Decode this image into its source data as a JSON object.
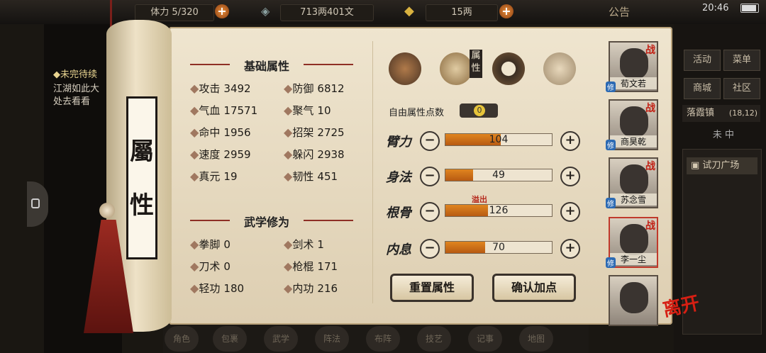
{
  "topbar": {
    "stamina": "5/320",
    "stamina_prefix": "体力",
    "money": "713两401文",
    "gold": "15两",
    "notice": "公告",
    "time": "20:46"
  },
  "quest": {
    "title": "◆未完待续",
    "lines": [
      "江湖如此大",
      "处去看看"
    ]
  },
  "roller": {
    "char1": "屬",
    "char2": "性"
  },
  "basic": {
    "title": "基础属性",
    "stats": [
      {
        "label": "攻击",
        "value": "3492"
      },
      {
        "label": "防御",
        "value": "6812"
      },
      {
        "label": "气血",
        "value": "17571"
      },
      {
        "label": "聚气",
        "value": "10"
      },
      {
        "label": "命中",
        "value": "1956"
      },
      {
        "label": "招架",
        "value": "2725"
      },
      {
        "label": "速度",
        "value": "2959"
      },
      {
        "label": "躲闪",
        "value": "2938"
      },
      {
        "label": "真元",
        "value": "19"
      },
      {
        "label": "韧性",
        "value": "451"
      }
    ]
  },
  "martial": {
    "title": "武学修为",
    "stats": [
      {
        "label": "拳脚",
        "value": "0"
      },
      {
        "label": "剑术",
        "value": "1"
      },
      {
        "label": "刀术",
        "value": "0"
      },
      {
        "label": "枪棍",
        "value": "171"
      },
      {
        "label": "轻功",
        "value": "180"
      },
      {
        "label": "内功",
        "value": "216"
      }
    ]
  },
  "tabs": {
    "attr_label": "属性"
  },
  "free_points": {
    "label": "自由属性点数",
    "value": "0"
  },
  "attributes": [
    {
      "name": "臂力",
      "value": "104",
      "level": 0.52
    },
    {
      "name": "身法",
      "value": "49",
      "level": 0.26
    },
    {
      "name": "根骨",
      "value": "126",
      "level": 0.4
    },
    {
      "name": "内息",
      "value": "70",
      "level": 0.37
    }
  ],
  "overflow_label": "溢出",
  "buttons": {
    "reset": "重置属性",
    "confirm": "确认加点"
  },
  "characters": [
    {
      "name": "荀文若",
      "war": "战",
      "repair": "修"
    },
    {
      "name": "商昊乾",
      "war": "战",
      "repair": "修"
    },
    {
      "name": "苏念雪",
      "war": "战",
      "repair": "修"
    },
    {
      "name": "李一尘",
      "war": "战",
      "repair": "修"
    },
    {
      "name": "",
      "war": "",
      "repair": ""
    }
  ],
  "leave": "离开",
  "right_menu": {
    "activity": "活动",
    "menu": "菜单",
    "shop": "商城",
    "community": "社区",
    "location": "落霞镇",
    "coords": "(18,12)",
    "compass": "未 中",
    "place": "试刀广场"
  },
  "bottom": [
    "角色",
    "包裹",
    "武学",
    "阵法",
    "布阵",
    "技艺",
    "记事",
    "地图"
  ]
}
